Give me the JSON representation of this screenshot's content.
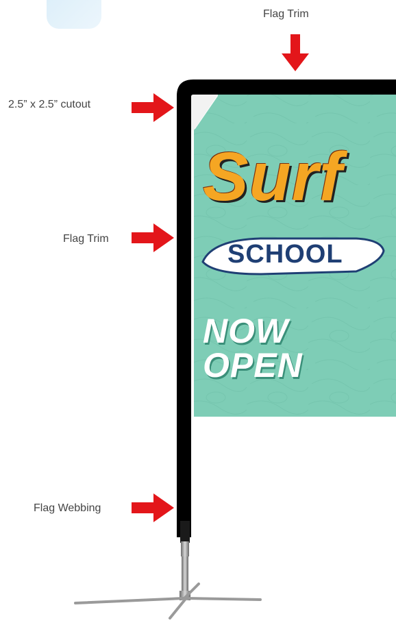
{
  "callouts": {
    "top_trim": "Flag Trim",
    "cutout": "2.5” x 2.5” cutout",
    "side_trim": "Flag Trim",
    "webbing": "Flag Webbing"
  },
  "banner": {
    "brand_line1": "Surf",
    "brand_line2": "SCHOOL",
    "tagline": "NOW OPEN"
  },
  "colors": {
    "arrow": "#e3161a",
    "banner_bg": "#7ecdb6",
    "trim": "#000000",
    "surf_orange": "#f5a623",
    "school_navy": "#1f3f74",
    "tagline_white": "#ffffff"
  }
}
